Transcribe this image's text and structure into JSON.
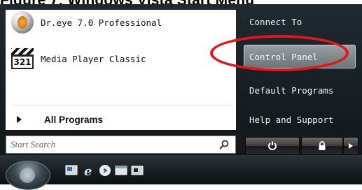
{
  "caption": {
    "text": "Figure 7: Windows Vista Start Menu"
  },
  "start_menu": {
    "programs": [
      {
        "label": "Dr.eye 7.0 Professional",
        "icon": "dr-eye-app-icon"
      },
      {
        "label": "Media Player Classic",
        "icon": "media-player-classic-icon",
        "icon_text": "321"
      }
    ],
    "all_programs_label": "All Programs",
    "search": {
      "placeholder": "Start Search"
    },
    "right_links": [
      {
        "label": "Connect To"
      },
      {
        "label": "Control Panel",
        "state": "hover"
      },
      {
        "label": "Default Programs"
      },
      {
        "label": "Help and Support"
      }
    ],
    "power_buttons": [
      {
        "icon": "power-icon"
      },
      {
        "icon": "lock-icon"
      },
      {
        "icon": "arrow-right-icon"
      }
    ]
  },
  "taskbar": {
    "start_orb": "windows-orb-icon",
    "quick_launch": [
      "show-desktop-icon",
      "internet-explorer-icon",
      "media-player-icon",
      "switch-windows-icon",
      "desktop-icon"
    ]
  },
  "colors": {
    "highlight_ellipse": "#e4151b",
    "hover_bg": "#8c9295",
    "panel_dark": "#1a2226"
  }
}
